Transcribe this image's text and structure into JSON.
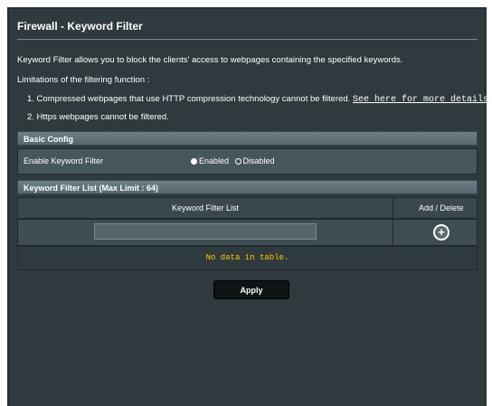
{
  "page": {
    "title": "Firewall - Keyword Filter",
    "description": "Keyword Filter allows you to block the clients' access to webpages containing the specified keywords.",
    "limitations_title": "Limitations of the filtering function :",
    "limitation_1": "1. Compressed webpages that use HTTP compression technology cannot be filtered.",
    "limitation_1_link": "See here for more details.",
    "limitation_2": "2. Https webpages cannot be filtered."
  },
  "basic_config": {
    "header": "Basic Config",
    "enable_label": "Enable Keyword Filter",
    "option_enabled": "Enabled",
    "option_disabled": "Disabled",
    "selected": "Enabled"
  },
  "keyword_list": {
    "header": "Keyword Filter List (Max Limit : 64)",
    "col_keyword": "Keyword Filter List",
    "col_action": "Add / Delete",
    "input_value": "",
    "add_icon": "plus-circle-icon",
    "empty_message": "No data in table."
  },
  "actions": {
    "apply_label": "Apply"
  },
  "colors": {
    "panel_bg": "#2f3a3e",
    "header_bg": "#6f7f85",
    "empty_text": "#ffc700"
  }
}
